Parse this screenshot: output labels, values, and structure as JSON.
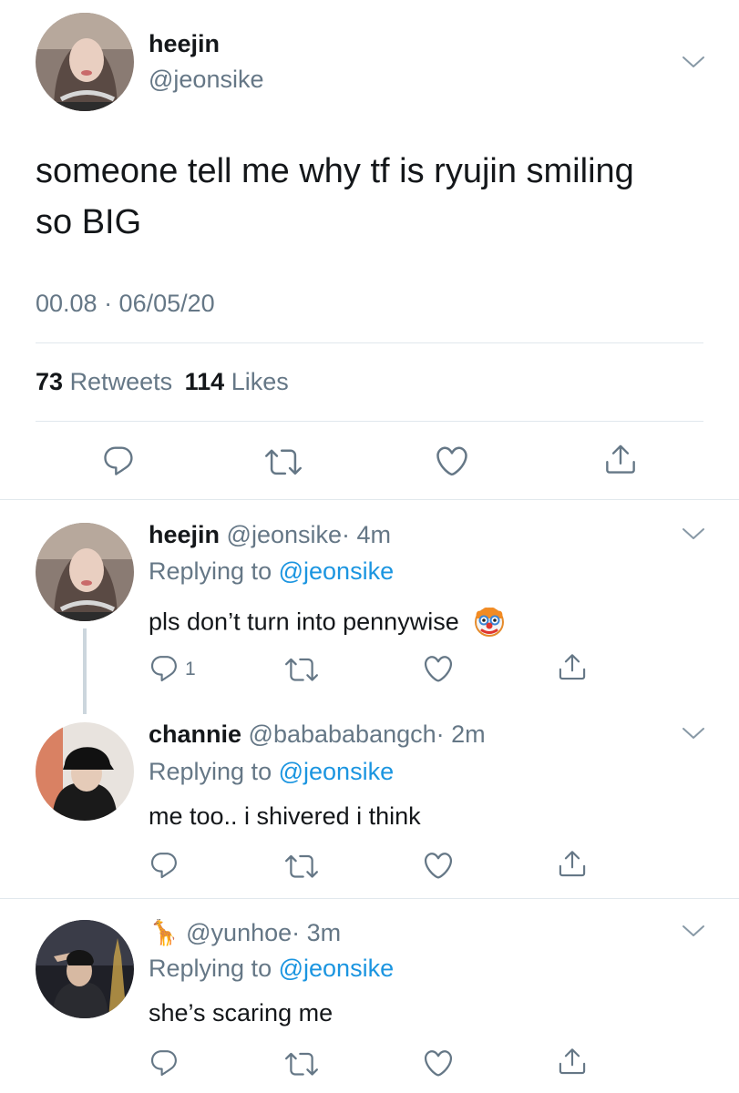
{
  "main_tweet": {
    "display_name": "heejin",
    "handle": "@jeonsike",
    "text_line1": "someone tell me why tf is ryujin smiling",
    "text_line2": "so BIG",
    "timestamp": "00.08 · 06/05/20",
    "retweets_count": "73",
    "retweets_label": "Retweets",
    "likes_count": "114",
    "likes_label": "Likes"
  },
  "replies": [
    {
      "display_name": "heejin",
      "handle": "@jeonsike",
      "time": "· 4m",
      "replying_label": "Replying to",
      "replying_handle": "@jeonsike",
      "text": "pls don’t turn into pennywise",
      "reply_count": "1"
    },
    {
      "display_name": "channie",
      "handle": "@babababangch",
      "time": "· 2m",
      "replying_label": "Replying to",
      "replying_handle": "@jeonsike",
      "text": "me too.. i shivered i think"
    },
    {
      "display_name_emoji": "🦒",
      "handle": "@yunhoe",
      "time": "· 3m",
      "replying_label": "Replying to",
      "replying_handle": "@jeonsike",
      "text": "she’s scaring me"
    }
  ],
  "colors": {
    "text": "#14171a",
    "secondary": "#657786",
    "link": "#1b95e0",
    "divider": "#e1e8ed"
  },
  "icons": [
    "reply-icon",
    "retweet-icon",
    "like-icon",
    "share-icon",
    "chevron-down-icon",
    "clown-emoji",
    "giraffe-emoji"
  ]
}
